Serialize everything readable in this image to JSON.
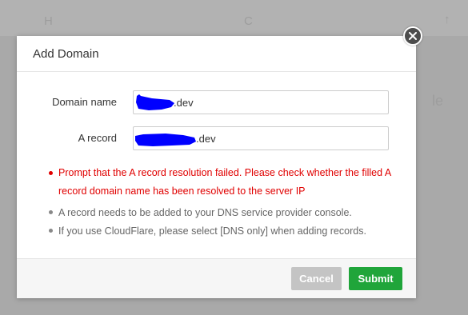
{
  "dialog": {
    "title": "Add Domain",
    "close_icon": "close-icon"
  },
  "form": {
    "domain_name": {
      "label": "Domain name",
      "value_suffix": ".dev"
    },
    "a_record": {
      "label": "A record",
      "value_suffix": ".dev"
    }
  },
  "tips": {
    "error": "Prompt that the A record resolution failed. Please check whether the filled A record domain name has been resolved to the server IP",
    "info": [
      "A record needs to be added to your DNS service provider console.",
      "If you use CloudFlare, please select [DNS only] when adding records."
    ]
  },
  "buttons": {
    "cancel": "Cancel",
    "submit": "Submit"
  },
  "colors": {
    "accent": "#20a53a",
    "error": "#e00000",
    "redaction": "#0000ff"
  }
}
